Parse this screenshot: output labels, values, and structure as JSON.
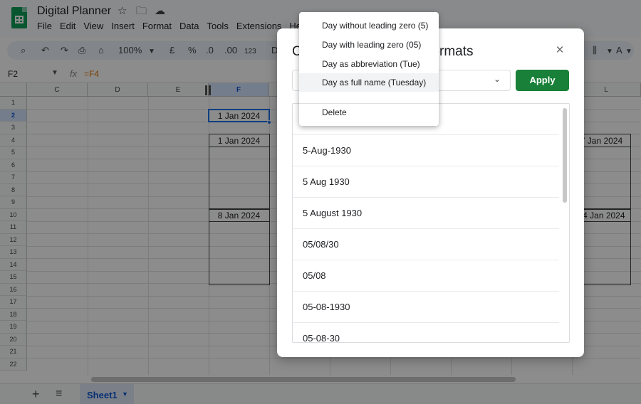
{
  "app": {
    "doc_title": "Digital Planner",
    "menu": [
      "File",
      "Edit",
      "View",
      "Insert",
      "Format",
      "Data",
      "Tools",
      "Extensions",
      "He"
    ]
  },
  "toolbar": {
    "zoom": "100%",
    "currency": "£",
    "percent": "%",
    "dec_decrease": ".0",
    "dec_increase": ".00",
    "number_format": "123",
    "font_partial": "D"
  },
  "formula_bar": {
    "cell_ref": "F2",
    "fx": "fx",
    "formula": "=F4"
  },
  "grid": {
    "columns": [
      {
        "label": "C"
      },
      {
        "label": "D"
      },
      {
        "label": "E"
      },
      {
        "label": "F"
      },
      {
        "label": ""
      },
      {
        "label": ""
      },
      {
        "label": ""
      },
      {
        "label": ""
      },
      {
        "label": "L"
      }
    ],
    "rows": [
      "1",
      "2",
      "3",
      "4",
      "5",
      "6",
      "7",
      "8",
      "9",
      "10",
      "11",
      "12",
      "13",
      "14",
      "15",
      "16",
      "17",
      "18",
      "19",
      "20",
      "21",
      "22"
    ],
    "cells": {
      "f2": "1 Jan 2024",
      "f4": "1 Jan 2024",
      "f10": "8 Jan 2024",
      "l4": "7 Jan 2024",
      "l10": "14 Jan 2024"
    }
  },
  "sheets": {
    "active": "Sheet1"
  },
  "dialog": {
    "title": "Custom date and time formats",
    "close": "×",
    "apply": "Apply",
    "formats": [
      "",
      "5-Aug-1930",
      "5 Aug 1930",
      "5 August 1930",
      "05/08/30",
      "05/08",
      "05-08-1930",
      "05-08-30"
    ]
  },
  "context_menu": {
    "items": [
      "Day without leading zero (5)",
      "Day with leading zero (05)",
      "Day as abbreviation (Tue)",
      "Day as full name (Tuesday)"
    ],
    "highlighted_index": 3,
    "delete": "Delete"
  },
  "colors": {
    "apply_green": "#188038",
    "selection_blue": "#1a73e8",
    "sheets_green": "#0f9d58"
  }
}
